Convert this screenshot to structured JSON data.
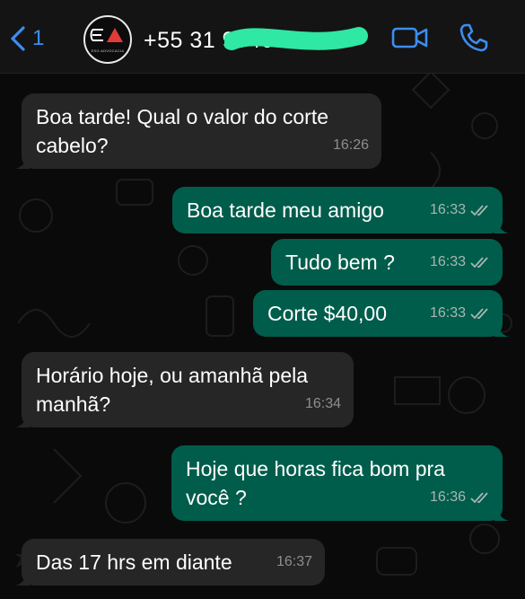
{
  "header": {
    "back_count": "1",
    "avatar_text": "ESG ADVOCACIA",
    "contact_name": "+55 31 9940",
    "icons": {
      "back": "chevron-left-icon",
      "video": "video-call-icon",
      "phone": "phone-call-icon"
    },
    "accent_color": "#3b8ef0"
  },
  "messages": [
    {
      "direction": "in",
      "text": "Boa tarde! Qual o valor do corte\ncabelo?",
      "time": "16:26"
    },
    {
      "direction": "out",
      "text": "Boa tarde meu amigo",
      "time": "16:33",
      "status": "read"
    },
    {
      "direction": "out",
      "text": "Tudo bem ?",
      "time": "16:33",
      "status": "read"
    },
    {
      "direction": "out",
      "text": "Corte $40,00",
      "time": "16:33",
      "status": "read"
    },
    {
      "direction": "in",
      "text": "Horário hoje, ou amanhã pela\nmanhã?",
      "time": "16:34"
    },
    {
      "direction": "out",
      "text": "Hoje que horas fica bom pra\nvocê ?",
      "time": "16:36",
      "status": "read"
    },
    {
      "direction": "in",
      "text": "Das 17 hrs em diante",
      "time": "16:37"
    }
  ],
  "colors": {
    "incoming_bubble": "#262626",
    "outgoing_bubble": "#005d4b",
    "background": "#0a0a0a"
  }
}
